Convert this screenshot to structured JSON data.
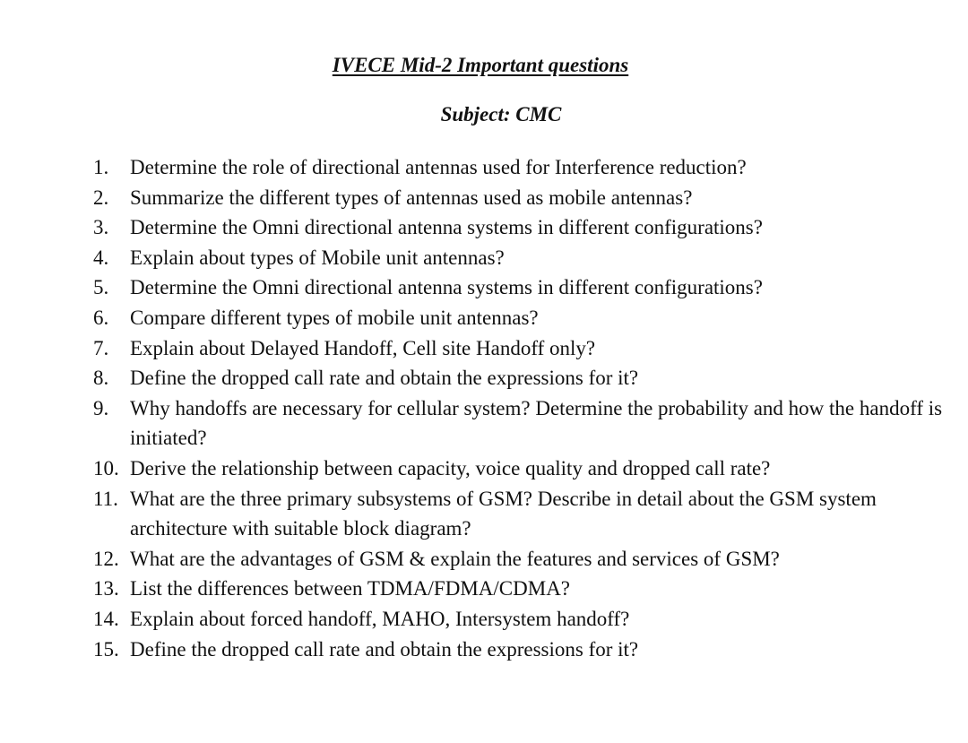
{
  "document": {
    "title": "IVECE Mid-2 Important questions",
    "subject": "Subject: CMC"
  },
  "questions": [
    {
      "number": "1.",
      "text": "Determine the role of directional antennas used for Interference reduction?"
    },
    {
      "number": "2.",
      "text": "Summarize the different types of antennas used as mobile antennas?"
    },
    {
      "number": "3.",
      "text": "Determine the Omni directional antenna systems in different configurations?"
    },
    {
      "number": "4.",
      "text": "Explain about types of Mobile unit antennas?"
    },
    {
      "number": "5.",
      "text": "Determine the Omni directional antenna systems in different configurations?"
    },
    {
      "number": "6.",
      "text": "Compare different types of mobile unit antennas?"
    },
    {
      "number": "7.",
      "text": "Explain about Delayed Handoff, Cell site Handoff only?"
    },
    {
      "number": "8.",
      "text": "Define the dropped call rate and obtain the expressions for it?"
    },
    {
      "number": "9.",
      "text": "Why handoffs are necessary for cellular system? Determine the probability and how the handoff is initiated?"
    },
    {
      "number": "10.",
      "text": "Derive the relationship between capacity, voice quality and dropped call rate?"
    },
    {
      "number": "11.",
      "text": "What are the three primary subsystems of GSM? Describe in detail about the GSM system architecture with suitable block diagram?"
    },
    {
      "number": "12.",
      "text": "What are the advantages of GSM & explain the features and services of GSM?"
    },
    {
      "number": "13.",
      "text": "List the differences between TDMA/FDMA/CDMA?"
    },
    {
      "number": "14.",
      "text": "Explain about forced handoff, MAHO, Intersystem handoff?"
    },
    {
      "number": "15.",
      "text": "Define the dropped call rate and obtain the expressions for it?"
    }
  ]
}
